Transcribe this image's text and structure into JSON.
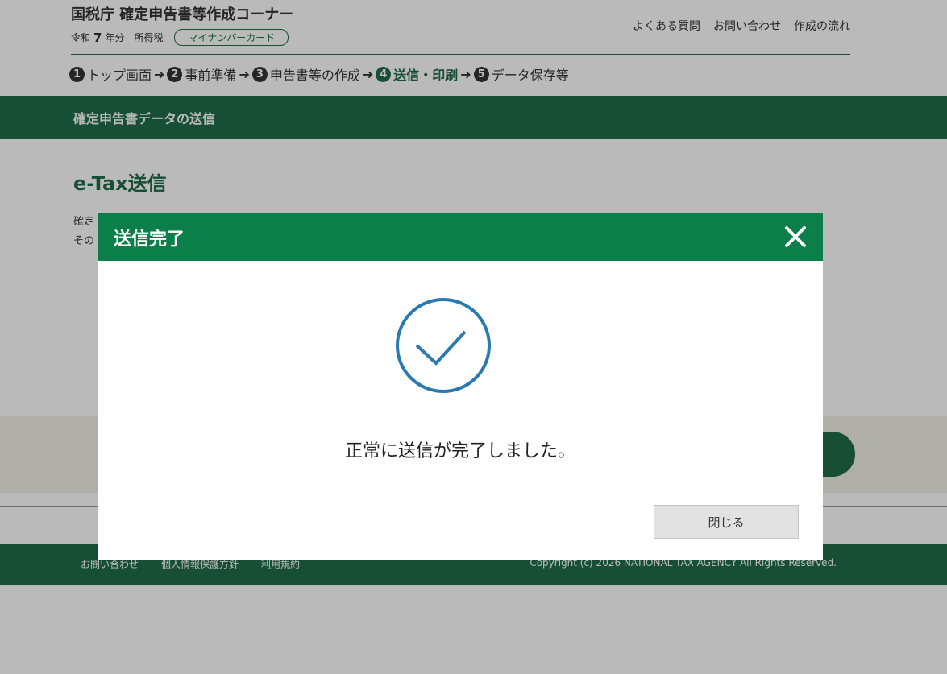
{
  "header": {
    "site_title": "国税庁 確定申告書等作成コーナー",
    "era": "令和",
    "year": "7",
    "year_suffix": "年分",
    "tax_type": "所得税",
    "badge": "マイナンバーカード",
    "links": [
      "よくある質問",
      "お問い合わせ",
      "作成の流れ"
    ]
  },
  "steps": [
    {
      "num": "1",
      "label": "トップ画面"
    },
    {
      "num": "2",
      "label": "事前準備"
    },
    {
      "num": "3",
      "label": "申告書等の作成"
    },
    {
      "num": "4",
      "label": "送信・印刷"
    },
    {
      "num": "5",
      "label": "データ保存等"
    }
  ],
  "active_step": "4",
  "section_title": "確定申告書データの送信",
  "page_heading": "e-Tax送信",
  "description_lines": [
    "確定",
    "その"
  ],
  "footer": {
    "links": [
      "お問い合わせ",
      "個人情報保護方針",
      "利用規約"
    ],
    "copyright": "Copyright (c)  2026 NATIONAL TAX AGENCY All Rights Reserved."
  },
  "modal": {
    "title": "送信完了",
    "message": "正常に送信が完了しました。",
    "close_label": "閉じる",
    "close_icon": "close-icon",
    "status_icon": "check-circle-icon"
  },
  "colors": {
    "brand_green": "#1f6b4a",
    "modal_header_green": "#0b7f49",
    "check_blue": "#2a7ab0"
  }
}
